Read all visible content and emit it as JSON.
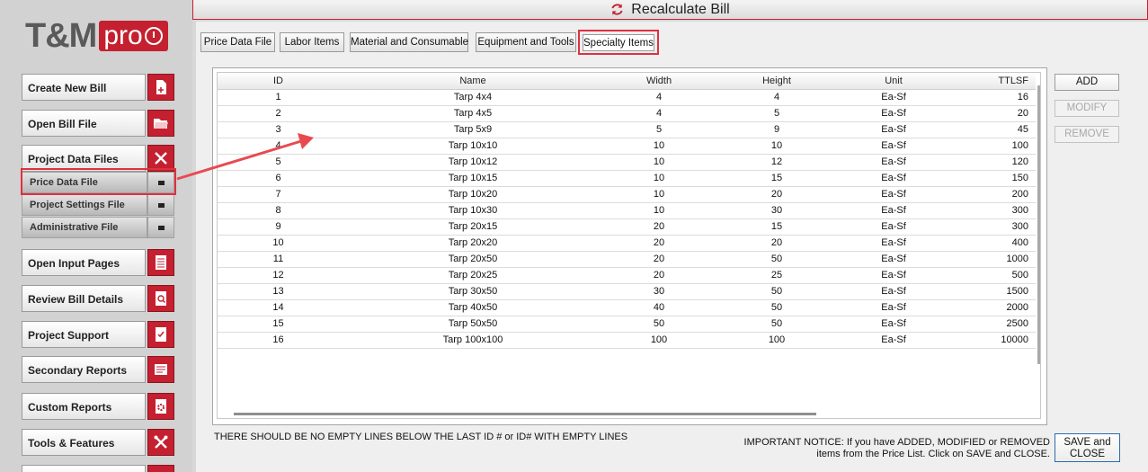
{
  "logo": {
    "text": "T&M",
    "badge": "pro"
  },
  "top_bar": {
    "label": "Recalculate Bill",
    "icon": "refresh-icon"
  },
  "sidebar": {
    "items": [
      {
        "label": "Create New Bill",
        "icon": "new-file-icon"
      },
      {
        "label": "Open Bill File",
        "icon": "folder-open-icon"
      },
      {
        "label": "Project Data Files",
        "icon": "close-icon"
      },
      {
        "label": "Open Input Pages",
        "icon": "input-pages-icon"
      },
      {
        "label": "Review Bill Details",
        "icon": "review-search-icon"
      },
      {
        "label": "Project Support",
        "icon": "checklist-icon"
      },
      {
        "label": "Secondary Reports",
        "icon": "reports-icon"
      },
      {
        "label": "Custom Reports",
        "icon": "gear-document-icon"
      },
      {
        "label": "Tools & Features",
        "icon": "tools-icon"
      }
    ],
    "sub_items": [
      {
        "label": "Price Data File"
      },
      {
        "label": "Project Settings File"
      },
      {
        "label": "Administrative File"
      }
    ]
  },
  "tabs": [
    {
      "label": "Price Data File"
    },
    {
      "label": "Labor Items"
    },
    {
      "label": "Material and Consumable"
    },
    {
      "label": "Equipment and Tools"
    },
    {
      "label": "Specialty Items",
      "active": true
    }
  ],
  "grid": {
    "columns": [
      "ID",
      "Name",
      "Width",
      "Height",
      "Unit",
      "TTLSF"
    ],
    "rows": [
      [
        "1",
        "Tarp 4x4",
        "4",
        "4",
        "Ea-Sf",
        "16"
      ],
      [
        "2",
        "Tarp 4x5",
        "4",
        "5",
        "Ea-Sf",
        "20"
      ],
      [
        "3",
        "Tarp 5x9",
        "5",
        "9",
        "Ea-Sf",
        "45"
      ],
      [
        "4",
        "Tarp 10x10",
        "10",
        "10",
        "Ea-Sf",
        "100"
      ],
      [
        "5",
        "Tarp 10x12",
        "10",
        "12",
        "Ea-Sf",
        "120"
      ],
      [
        "6",
        "Tarp 10x15",
        "10",
        "15",
        "Ea-Sf",
        "150"
      ],
      [
        "7",
        "Tarp 10x20",
        "10",
        "20",
        "Ea-Sf",
        "200"
      ],
      [
        "8",
        "Tarp 10x30",
        "10",
        "30",
        "Ea-Sf",
        "300"
      ],
      [
        "9",
        "Tarp 20x15",
        "20",
        "15",
        "Ea-Sf",
        "300"
      ],
      [
        "10",
        "Tarp 20x20",
        "20",
        "20",
        "Ea-Sf",
        "400"
      ],
      [
        "11",
        "Tarp 20x50",
        "20",
        "50",
        "Ea-Sf",
        "1000"
      ],
      [
        "12",
        "Tarp 20x25",
        "20",
        "25",
        "Ea-Sf",
        "500"
      ],
      [
        "13",
        "Tarp 30x50",
        "30",
        "50",
        "Ea-Sf",
        "1500"
      ],
      [
        "14",
        "Tarp 40x50",
        "40",
        "50",
        "Ea-Sf",
        "2000"
      ],
      [
        "15",
        "Tarp 50x50",
        "50",
        "50",
        "Ea-Sf",
        "2500"
      ],
      [
        "16",
        "Tarp 100x100",
        "100",
        "100",
        "Ea-Sf",
        "10000"
      ]
    ]
  },
  "buttons": {
    "add": "ADD",
    "modify": "MODIFY",
    "remove": "REMOVE",
    "save_line1": "SAVE and",
    "save_line2": "CLOSE"
  },
  "notices": {
    "warning": "THERE SHOULD BE NO EMPTY LINES BELOW THE LAST ID # or ID# WITH EMPTY LINES",
    "important_line1": "IMPORTANT NOTICE:  If you have ADDED, MODIFIED or REMOVED",
    "important_line2": "items from the Price List.  Click on SAVE and CLOSE."
  },
  "colors": {
    "accent_red": "#c42030",
    "highlight_red": "#e0303e",
    "save_border": "#2b6cb0"
  }
}
